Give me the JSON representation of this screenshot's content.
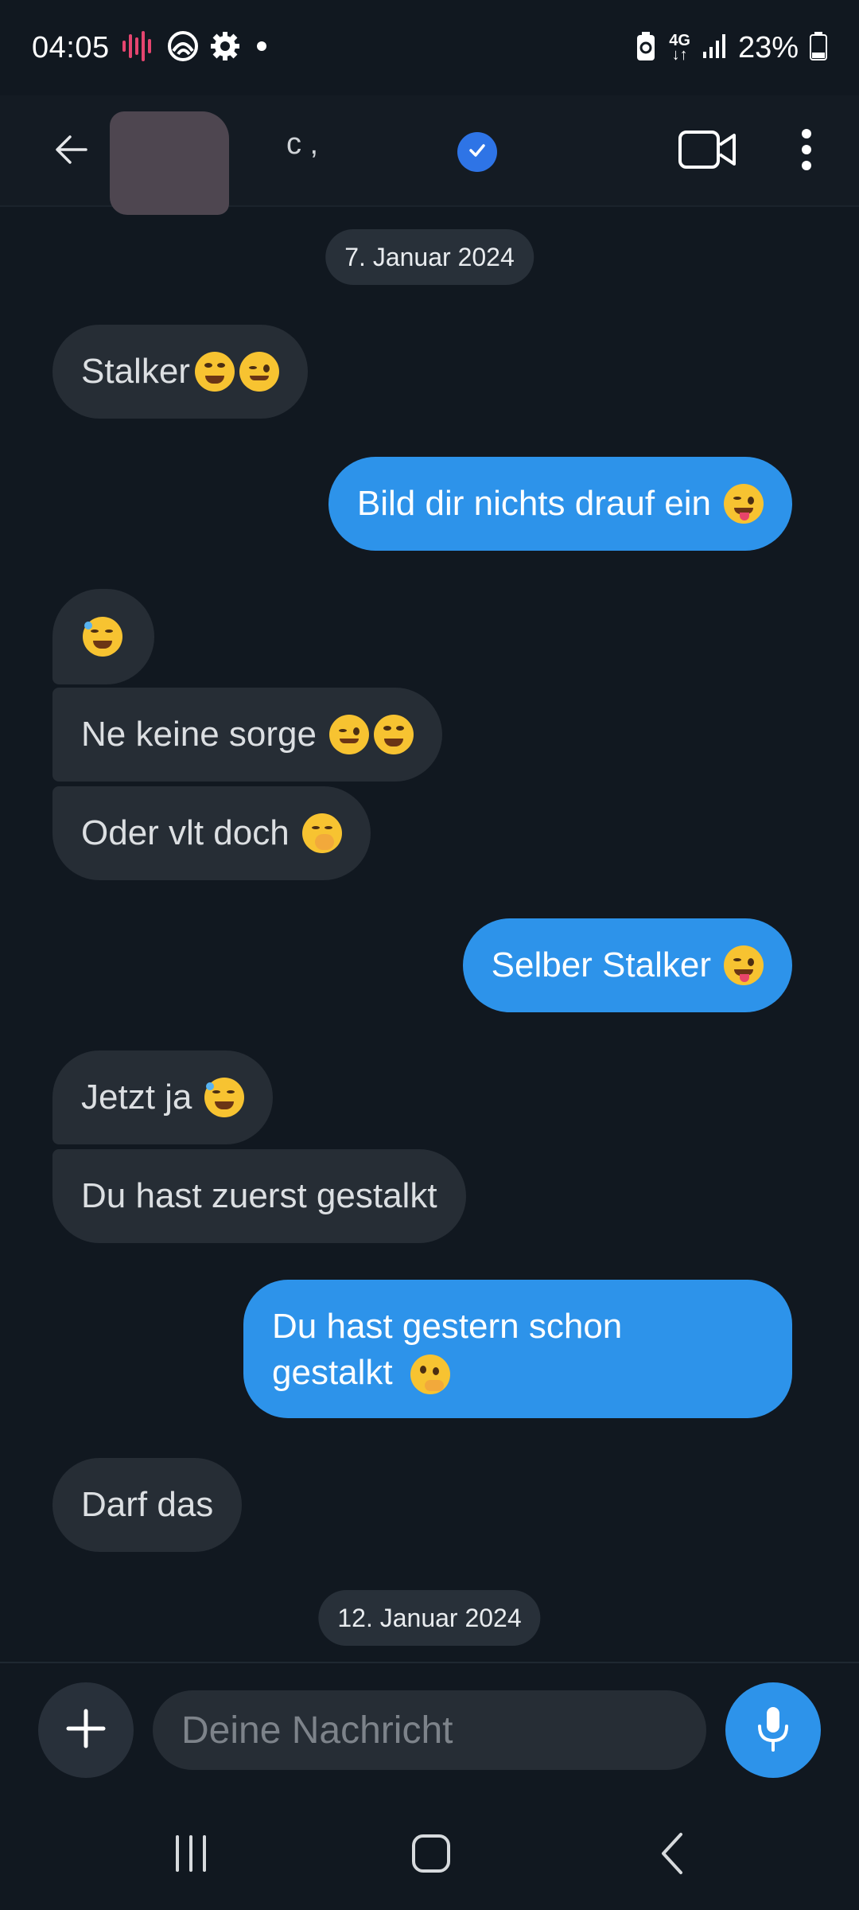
{
  "status_bar": {
    "time": "04:05",
    "network": "4G",
    "battery": "23%"
  },
  "header": {
    "contact_name": "c    ,",
    "verified": true,
    "back_icon": "back-arrow-icon",
    "video_icon": "video-call-icon",
    "more_icon": "more-vert-icon"
  },
  "chat": {
    "dates": [
      {
        "label": "7. Januar 2024"
      },
      {
        "label": "12. Januar 2024"
      }
    ],
    "messages": [
      {
        "direction": "in",
        "text": "Stalker",
        "emoji": [
          "grin",
          "wink"
        ]
      },
      {
        "direction": "out",
        "text": "Bild dir nichts drauf ein",
        "emoji": [
          "tongue-wink"
        ]
      },
      {
        "direction": "in",
        "text": "",
        "emoji": [
          "rofl"
        ]
      },
      {
        "direction": "in",
        "text": "Ne keine sorge",
        "emoji": [
          "wink",
          "grin"
        ]
      },
      {
        "direction": "in",
        "text": "Oder vlt doch",
        "emoji": [
          "hand-over-mouth"
        ]
      },
      {
        "direction": "out",
        "text": "Selber Stalker",
        "emoji": [
          "tongue-wink"
        ]
      },
      {
        "direction": "in",
        "text": "Jetzt ja",
        "emoji": [
          "rofl"
        ]
      },
      {
        "direction": "in",
        "text": "Du hast zuerst gestalkt",
        "emoji": []
      },
      {
        "direction": "out",
        "text": "Du hast gestern schon",
        "text2": "gestalkt",
        "emoji": [
          "thinking"
        ]
      },
      {
        "direction": "in",
        "text": "Darf das",
        "emoji": []
      }
    ]
  },
  "composer": {
    "placeholder": "Deine Nachricht",
    "value": "",
    "add_icon": "plus-icon",
    "mic_icon": "microphone-icon"
  },
  "colors": {
    "background": "#111820",
    "incoming_bubble": "#262d35",
    "outgoing_bubble": "#2d93ea",
    "accent": "#2d93ea",
    "verified_badge": "#2e74e6"
  }
}
